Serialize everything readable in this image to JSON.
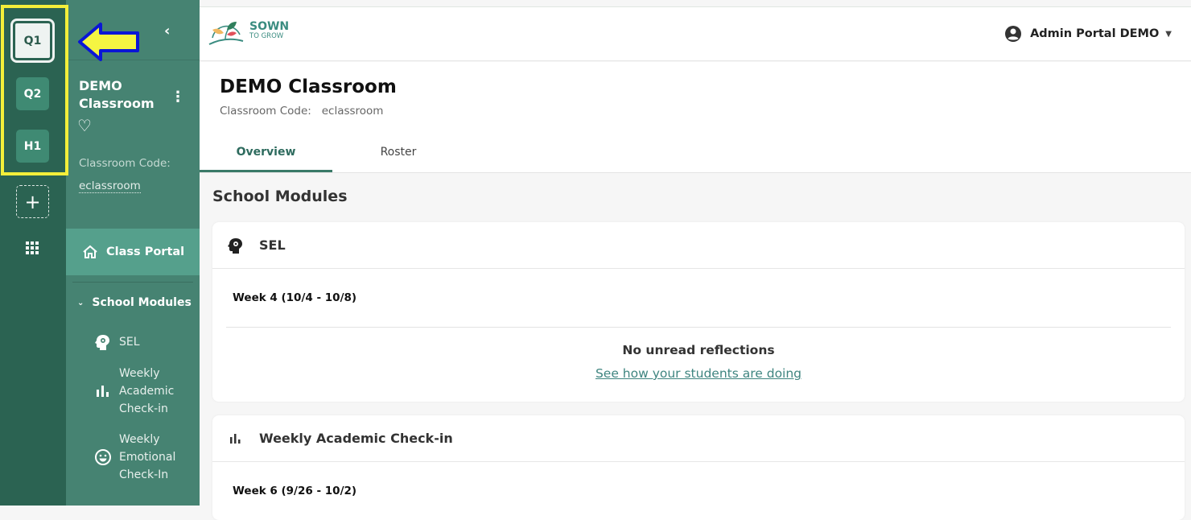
{
  "rail": {
    "items": [
      {
        "label": "Q1",
        "active": true
      },
      {
        "label": "Q2",
        "active": false
      },
      {
        "label": "H1",
        "active": false
      }
    ],
    "add_label": "+",
    "apps_icon": "grid-icon"
  },
  "sidebar": {
    "collapse_icon": "‹",
    "class_title": "DEMO Classroom",
    "class_title_line1": "DEMO",
    "class_title_line2": "Classroom",
    "menu_icon": "⋮",
    "favorite_icon": "♡",
    "code_label": "Classroom Code:",
    "code_value": "eclassroom",
    "portal_label": "Class Portal",
    "modules_label": "School Modules",
    "modules_chevron": "⌄",
    "module_items": [
      {
        "label": "SEL",
        "icon": "head-gear-icon"
      },
      {
        "label": "Weekly Academic Check-in",
        "lines": [
          "Weekly",
          "Academic",
          "Check-in"
        ],
        "icon": "bar-chart-icon"
      },
      {
        "label": "Weekly Emotional Check-In",
        "lines": [
          "Weekly",
          "Emotional",
          "Check-In"
        ],
        "icon": "smiley-icon"
      }
    ]
  },
  "topbar": {
    "logo_line1": "SOWN",
    "logo_line2": "TO GROW",
    "user_label": "Admin Portal DEMO",
    "caret": "▼"
  },
  "header": {
    "title": "DEMO Classroom",
    "code_label": "Classroom Code:",
    "code_value": "eclassroom",
    "tabs": [
      {
        "label": "Overview",
        "active": true
      },
      {
        "label": "Roster",
        "active": false
      }
    ]
  },
  "main": {
    "section_title": "School Modules",
    "cards": [
      {
        "title": "SEL",
        "week": "Week 4 (10/4 - 10/8)",
        "empty_title": "No unread reflections",
        "link": "See how your students are doing"
      },
      {
        "title": "Weekly Academic Check-in",
        "week": "Week 6 (9/26 - 10/2)"
      }
    ]
  },
  "colors": {
    "rail_bg": "#2b6352",
    "sidebar_bg": "#468372",
    "active_item_bg": "#55a08c",
    "accent": "#3a7a68",
    "highlight": "#f4ef3a",
    "arrow_fill": "#f5f542",
    "arrow_stroke": "#0a16d6"
  }
}
